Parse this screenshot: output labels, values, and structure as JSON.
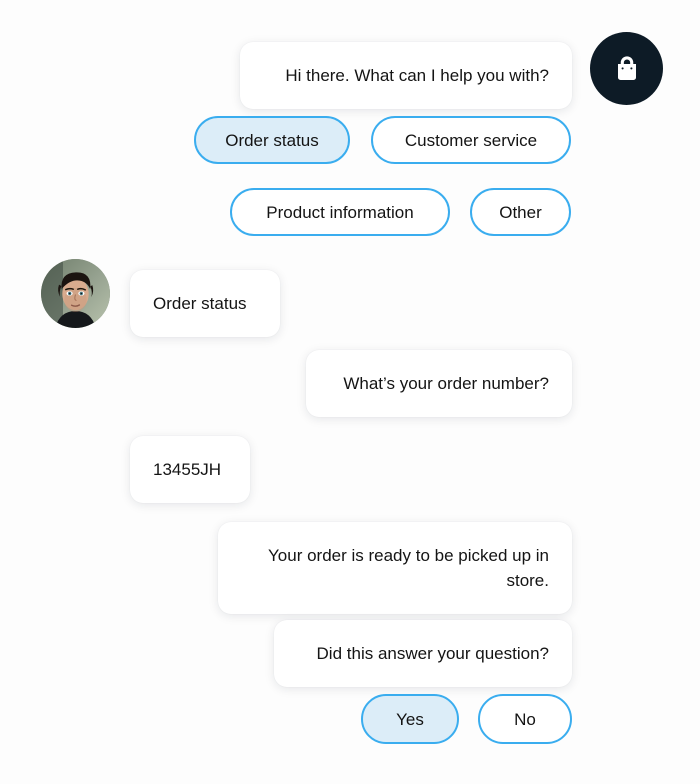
{
  "brand": {
    "icon": "shopping-bag-icon",
    "circle_color": "#0d1b26",
    "icon_color": "#ffffff"
  },
  "user": {
    "avatar": "user-photo-avatar"
  },
  "theme": {
    "background": "#fdfdfd",
    "bubble_background": "#ffffff",
    "text_color": "#141414",
    "chip_border": "#3aadef",
    "chip_selected_fill": "#dcedf8"
  },
  "conversation": {
    "messages": [
      {
        "id": "greeting",
        "sender": "bot",
        "align": "right",
        "text": "Hi there. What can I help you with?"
      },
      {
        "id": "order-status-reply",
        "sender": "user",
        "align": "left",
        "text": "Order status"
      },
      {
        "id": "ask-order-number",
        "sender": "bot",
        "align": "right",
        "text": "What’s your order number?"
      },
      {
        "id": "order-number",
        "sender": "user",
        "align": "left",
        "text": "13455JH"
      },
      {
        "id": "order-ready",
        "sender": "bot",
        "align": "right",
        "text": "Your order is ready to be picked up in store."
      },
      {
        "id": "did-answer",
        "sender": "bot",
        "align": "right",
        "text": "Did this answer your question?"
      }
    ]
  },
  "quick_replies": {
    "topic_options": [
      {
        "id": "order-status",
        "label": "Order status",
        "selected": true
      },
      {
        "id": "customer-service",
        "label": "Customer service",
        "selected": false
      },
      {
        "id": "product-info",
        "label": "Product information",
        "selected": false
      },
      {
        "id": "other",
        "label": "Other",
        "selected": false
      }
    ],
    "feedback_options": [
      {
        "id": "yes",
        "label": "Yes",
        "selected": true
      },
      {
        "id": "no",
        "label": "No",
        "selected": false
      }
    ]
  }
}
